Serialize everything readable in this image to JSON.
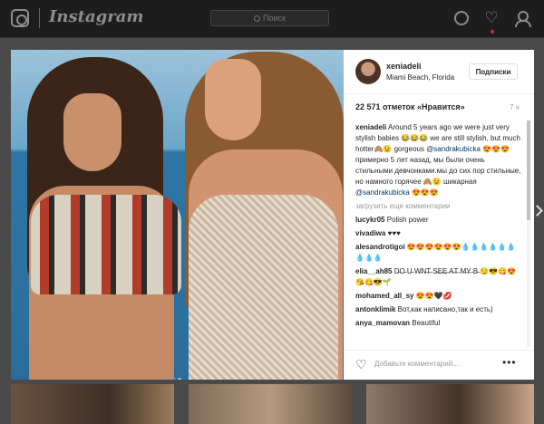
{
  "header": {
    "brand": "Instagram",
    "search_placeholder": "Поиск"
  },
  "post": {
    "username": "xeniadeli",
    "location": "Miami Beach, Florida",
    "follow_label": "Подписки",
    "likes": "22 571 отметок «Нравится»",
    "age": "7 ч",
    "add_comment_placeholder": "Добавьте комментарий...",
    "caption": {
      "user": "xeniadeli",
      "text_before": " Around 5 years ago we were just very stylish babies 😂😂😂 we are still stylish, but much hotter🙈😉 gorgeous ",
      "mention1": "@sandrakubicka",
      "text_middle": " 😍😍😍 примерно 5 лет назад, мы были очень стильными девчонками.мы до сих пор стильные, но намного горячее 🙈😉 шикарная ",
      "mention2": "@sandrakubicka",
      "text_after": " 😍😍😍"
    },
    "load_more": "загрузить еще комментарии",
    "comments": [
      {
        "user": "lucykr05",
        "text": " Polish power"
      },
      {
        "user": "vivadiwa",
        "text": " ♥♥♥"
      },
      {
        "user": "alesandrotigoi",
        "text": " 😍😍😍😍😍😍💧💧💧💧💧💧💧💧💧"
      },
      {
        "user": "elia__ah85",
        "text": " D̶O̶ U̶ W̶N̶T̶ S̶E̶E̶ A̶T̶ M̶Y̶ B̶ 😏😎😋😍😘😋😎🌱"
      },
      {
        "user": "mohamed_all_sy",
        "text": " 😍😍🖤💋"
      },
      {
        "user": "antonklimik",
        "text": " Вот,как написано,так и есть)"
      },
      {
        "user": "anya_mamovan",
        "text": " Beautiful"
      }
    ]
  }
}
